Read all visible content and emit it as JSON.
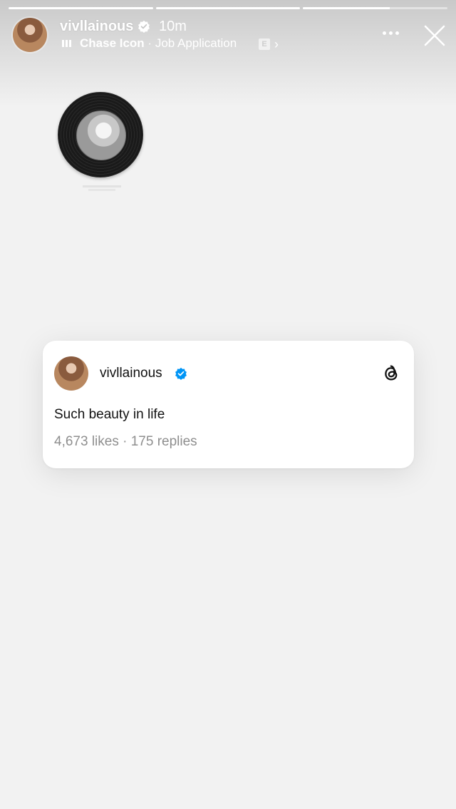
{
  "story": {
    "progress": [
      1.0,
      1.0,
      0.6
    ],
    "username": "vivllainous",
    "time": "10m",
    "music": {
      "song": "Chase Icon",
      "separator": " · ",
      "detail": "Job Application",
      "explicit_badge": "E"
    },
    "icons": {
      "verified": "verified-badge-icon",
      "more": "more-dots-icon",
      "close": "close-icon",
      "chevron": "chevron-right-icon",
      "music": "music-bars-icon"
    }
  },
  "threads_card": {
    "username": "vivllainous",
    "text": "Such beauty in life",
    "stats": "4,673 likes · 175 replies",
    "icon": "threads-logo-icon"
  },
  "colors": {
    "background": "#f2f2f2",
    "verified_blue": "#0095f6"
  }
}
